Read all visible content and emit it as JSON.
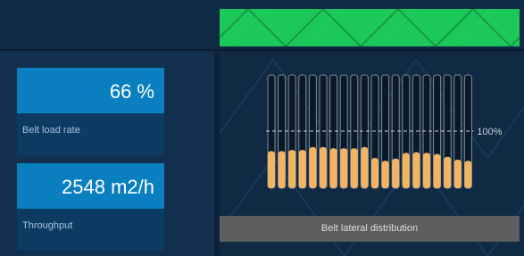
{
  "belt_load": {
    "value": "66 %",
    "label": "Belt load rate"
  },
  "throughput": {
    "value": "2548 m2/h",
    "label": "Throughput"
  },
  "distribution": {
    "caption": "Belt lateral distribution",
    "reference_label": "100%",
    "reference_level": 1.0,
    "levels": [
      0.65,
      0.65,
      0.67,
      0.67,
      0.72,
      0.72,
      0.7,
      0.7,
      0.7,
      0.72,
      0.53,
      0.48,
      0.52,
      0.62,
      0.63,
      0.62,
      0.6,
      0.55,
      0.5,
      0.48
    ],
    "colors": {
      "bar": "#f2b462",
      "track": "#0b1826",
      "track_border": "#7f8c99",
      "reference_line": "#d0d6dc"
    }
  },
  "status_strip": {
    "color": "#1dc85a"
  }
}
